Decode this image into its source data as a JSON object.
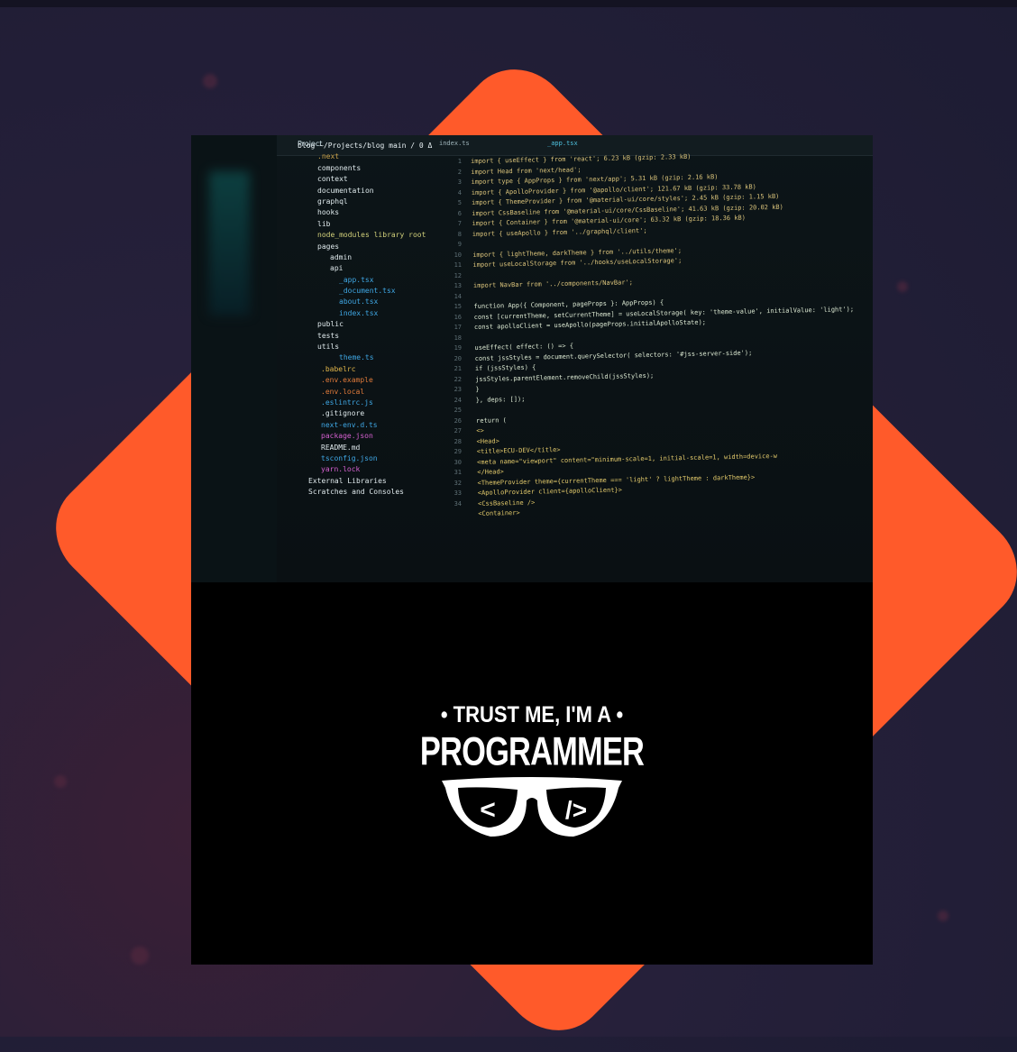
{
  "ide": {
    "project_label": "Project",
    "tabs": [
      "index.ts",
      "_app.tsx"
    ],
    "tree": [
      "blog  ~/Projects/blog main / 0 Δ",
      ".next",
      "components",
      "context",
      "documentation",
      "graphql",
      "hooks",
      "lib",
      "node_modules  library root",
      "pages",
      "admin",
      "api",
      "_app.tsx",
      "_document.tsx",
      "about.tsx",
      "index.tsx",
      "public",
      "tests",
      "utils",
      "theme.ts",
      ".babelrc",
      ".env.example",
      ".env.local",
      ".eslintrc.js",
      ".gitignore",
      "next-env.d.ts",
      "package.json",
      "README.md",
      "tsconfig.json",
      "yarn.lock",
      "External Libraries",
      "Scratches and Consoles"
    ],
    "line_numbers": [
      "1",
      "2",
      "3",
      "4",
      "5",
      "6",
      "7",
      "8",
      "9",
      "10",
      "11",
      "12",
      "13",
      "14",
      "15",
      "16",
      "17",
      "18",
      "19",
      "20",
      "21",
      "22",
      "23",
      "24",
      "25",
      "26",
      "27",
      "28",
      "29",
      "30",
      "31",
      "32",
      "33",
      "34"
    ],
    "code_lines": [
      "import { useEffect } from 'react';  6.23 kB (gzip: 2.33 kB)",
      "import Head from 'next/head';",
      "import type { AppProps } from 'next/app';  5.31 kB (gzip: 2.16 kB)",
      "import { ApolloProvider } from '@apollo/client';  121.67 kB (gzip: 33.78 kB)",
      "import { ThemeProvider } from '@material-ui/core/styles';  2.45 kB (gzip: 1.15 kB)",
      "import CssBaseline from '@material-ui/core/CssBaseline';  41.63 kB (gzip: 20.02 kB)",
      "import { Container } from '@material-ui/core';  63.32 kB (gzip: 18.36 kB)",
      "import { useApollo } from '../graphql/client';",
      "",
      "import { lightTheme, darkTheme } from '../utils/theme';",
      "import useLocalStorage from '../hooks/useLocalStorage';",
      "",
      "import NavBar from '../components/NavBar';",
      "",
      "function App({ Component, pageProps }: AppProps) {",
      "  const [currentTheme, setCurrentTheme] = useLocalStorage( key: 'theme-value',  initialValue: 'light');",
      "  const apolloClient = useApollo(pageProps.initialApolloState);",
      "",
      "  useEffect( effect: () => {",
      "    const jssStyles = document.querySelector( selectors: '#jss-server-side');",
      "    if (jssStyles) {",
      "      jssStyles.parentElement.removeChild(jssStyles);",
      "    }",
      "  },  deps: []);",
      "",
      "  return (",
      "    <>",
      "      <Head>",
      "        <title>ECU-DEV</title>",
      "        <meta name=\"viewport\" content=\"minimum-scale=1, initial-scale=1, width=device-w",
      "      </Head>",
      "      <ThemeProvider theme={currentTheme === 'light' ? lightTheme : darkTheme}>",
      "        <ApolloProvider client={apolloClient}>",
      "          <CssBaseline />",
      "          <Container>"
    ]
  },
  "meme": {
    "top_line": "• TRUST ME, I'M A •",
    "main_line": "PROGRAMMER",
    "glasses_left": "<",
    "glasses_right": "/>"
  },
  "colors": {
    "background": "#1d1c33",
    "diamond": "#ff5a2a",
    "meme_bg": "#000000",
    "meme_text": "#ffffff"
  }
}
